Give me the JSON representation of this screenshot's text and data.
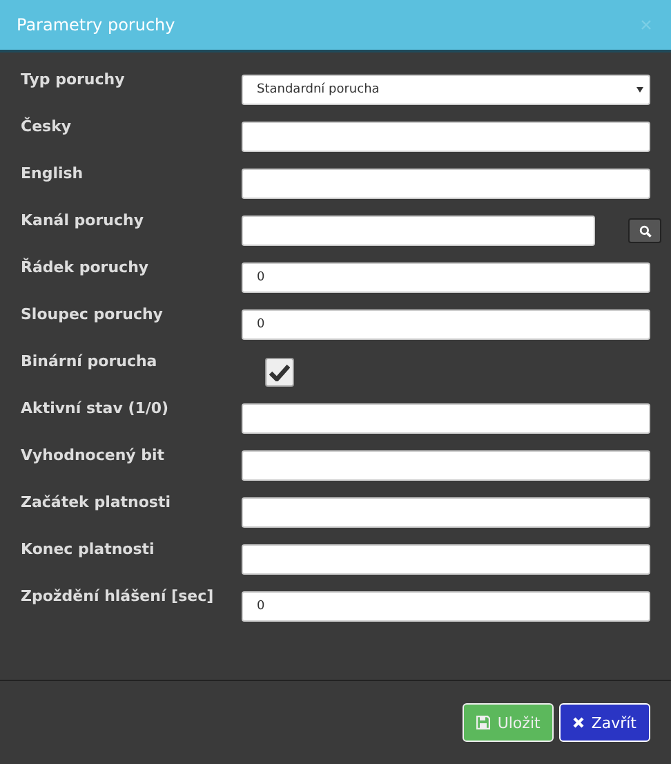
{
  "dialog": {
    "title": "Parametry poruchy"
  },
  "fields": [
    {
      "kind": "select",
      "label": "Typ poruchy",
      "value": "Standardní porucha"
    },
    {
      "kind": "text",
      "label": "Česky"
    },
    {
      "kind": "text",
      "label": "English"
    },
    {
      "kind": "search",
      "label": "Kanál poruchy"
    },
    {
      "kind": "text",
      "label": "Řádek poruchy",
      "value": "0"
    },
    {
      "kind": "text",
      "label": "Sloupec poruchy",
      "value": "0"
    },
    {
      "kind": "checkbox",
      "label": "Binární porucha",
      "checked": true
    },
    {
      "kind": "text",
      "label": "Aktivní stav (1/0)"
    },
    {
      "kind": "text",
      "label": "Vyhodnocený bit"
    },
    {
      "kind": "text",
      "label": "Začátek platnosti"
    },
    {
      "kind": "text",
      "label": "Konec platnosti"
    },
    {
      "kind": "text",
      "label": "Zpoždění hlášení [sec]",
      "value": "0"
    }
  ],
  "buttons": [
    {
      "kind": "save",
      "label": "Uložit"
    },
    {
      "kind": "close",
      "label": "Zavřít"
    }
  ]
}
